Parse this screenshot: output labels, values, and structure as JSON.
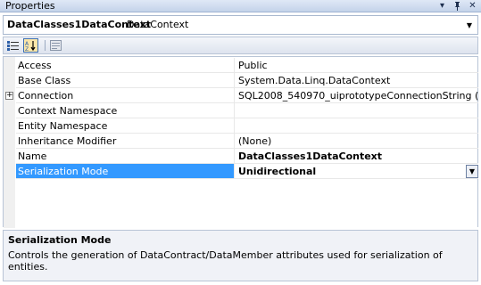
{
  "window": {
    "title": "Properties",
    "controls": {
      "dropdown_glyph": "▾",
      "pin_glyph": "‡",
      "close_glyph": "✕"
    }
  },
  "object_selector": {
    "name": "DataClasses1DataContext",
    "type": "DataContext"
  },
  "toolbar": {
    "buttons": [
      {
        "name": "categorized-icon",
        "active": false
      },
      {
        "name": "alphabetical-icon",
        "active": true
      },
      {
        "name": "property-pages-icon",
        "active": false
      }
    ]
  },
  "properties": [
    {
      "name": "Access",
      "value": "Public"
    },
    {
      "name": "Base Class",
      "value": "System.Data.Linq.DataContext"
    },
    {
      "name": "Connection",
      "value": "SQL2008_540970_uiprototypeConnectionString (Web.con",
      "expandable": true
    },
    {
      "name": "Context Namespace",
      "value": ""
    },
    {
      "name": "Entity Namespace",
      "value": ""
    },
    {
      "name": "Inheritance Modifier",
      "value": "(None)"
    },
    {
      "name": "Name",
      "value": "DataClasses1DataContext",
      "bold": true
    },
    {
      "name": "Serialization Mode",
      "value": "Unidirectional",
      "bold": true,
      "selected": true
    }
  ],
  "description": {
    "title": "Serialization Mode",
    "text": "Controls the generation of DataContract/DataMember attributes used for serialization of entities."
  },
  "colors": {
    "selection": "#3399ff",
    "title_bar": "#c4d3ea",
    "description_bg": "#f0f2f7"
  }
}
